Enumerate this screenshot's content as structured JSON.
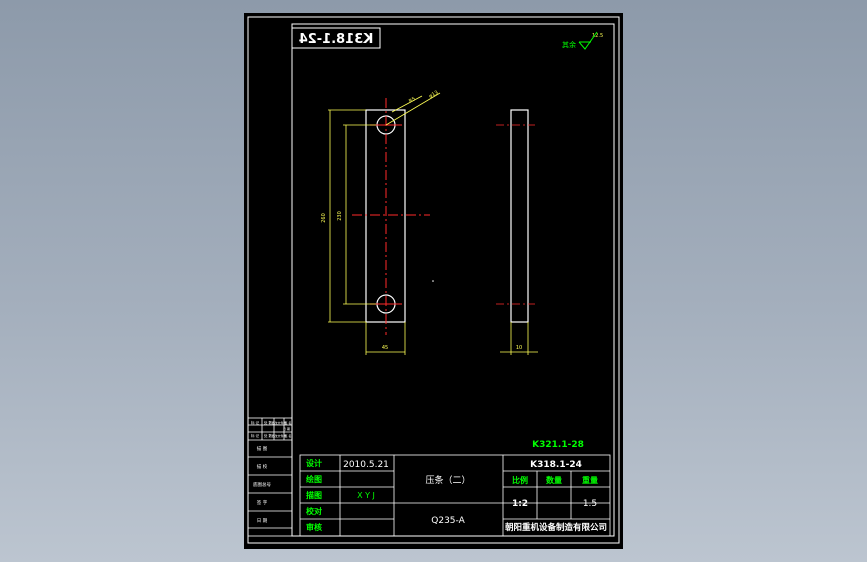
{
  "drawing": {
    "code_mirrored": "K318.1-24",
    "roughness_label": "其余",
    "roughness_value": "12.5"
  },
  "dimensions": {
    "overall_height": "260",
    "hole_spacing": "230",
    "width": "45",
    "thickness": "10",
    "hole_radius": "R5",
    "hole_diameter": "φ13"
  },
  "left_strip": {
    "rows": [
      "标 记",
      "处 数",
      "更改文件号",
      "签 名",
      "日 期",
      "标 记",
      "处 数",
      "更改文件号",
      "签 名",
      "日 期"
    ],
    "block_labels": [
      "描 图",
      "描 校",
      "底图总号",
      "签 字",
      "日 期"
    ]
  },
  "title_block": {
    "assembly_ref": "K321.1-28",
    "roles": [
      "设计",
      "绘图",
      "描图",
      "校对",
      "审核"
    ],
    "design_date": "2010.5.21",
    "drafter": "X Y J",
    "part_name": "压条（二）",
    "material": "Q235-A",
    "drawing_number": "K318.1-24",
    "header_ratio": "比例",
    "header_qty": "数量",
    "header_weight": "重量",
    "ratio": "1:2",
    "quantity": "",
    "weight": "1.5",
    "company": "朝阳重机设备制造有限公司"
  },
  "colors": {
    "background_sheet": "#000000",
    "line_white": "#ffffff",
    "text_yellow": "#ffff55",
    "label_green": "#00ff00",
    "center_red": "#ff2a2a"
  }
}
